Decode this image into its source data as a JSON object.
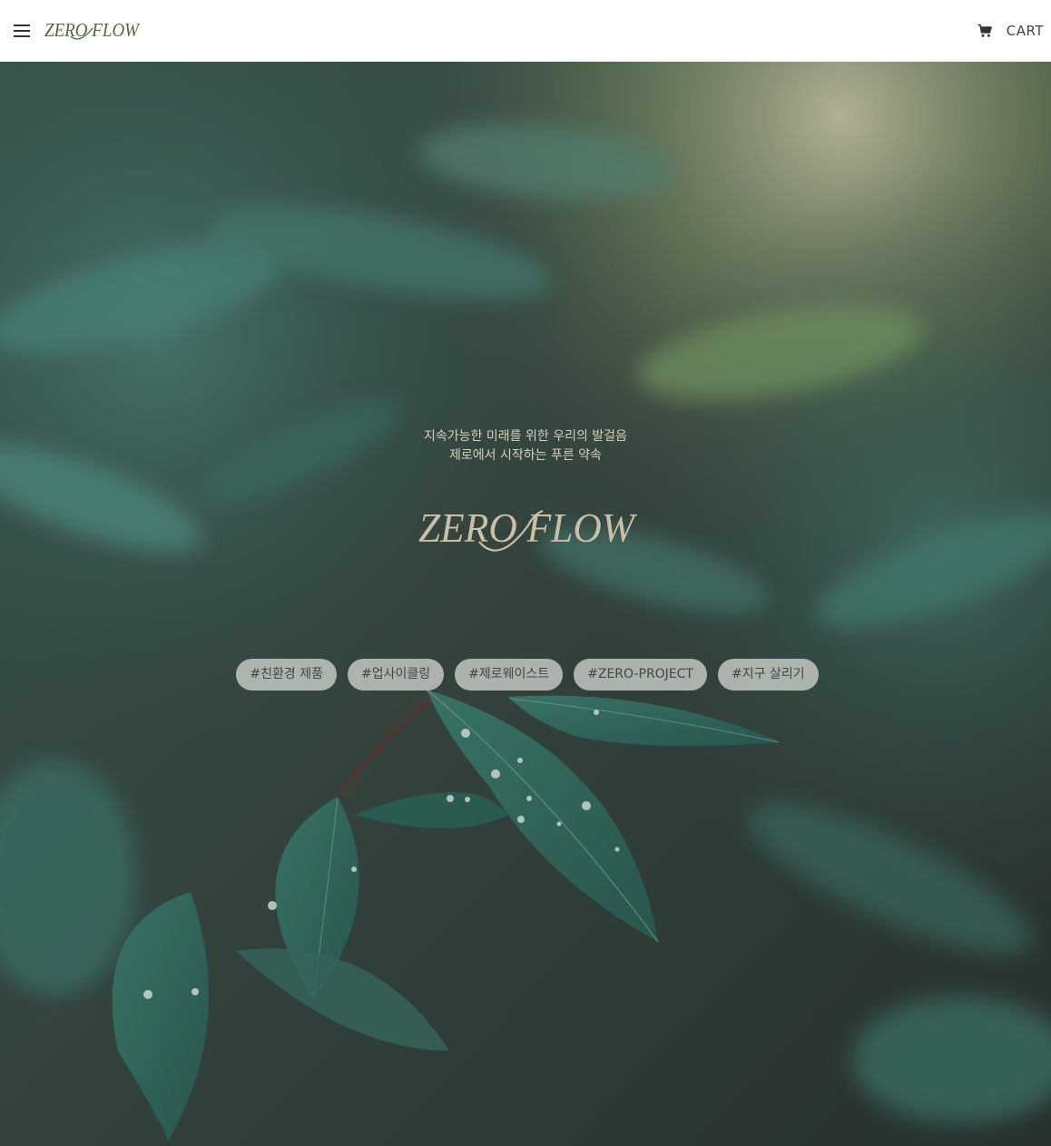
{
  "header": {
    "menu_icon": "hamburger-menu-icon",
    "logo_text": "ZERO FLOW",
    "cart_icon": "shopping-cart-icon",
    "cart_label": "CART"
  },
  "hero": {
    "tagline_line1": "지속가능한 미래를 위한 우리의 발걸음",
    "tagline_line2": "제로에서 시작하는 푸른 약속",
    "logo_text": "ZERO FLOW",
    "tags": [
      "#친환경 제품",
      "#업사이클링",
      "#제로웨이스트",
      "#ZERO-PROJECT",
      "#지구 살리기"
    ]
  },
  "colors": {
    "brand_green": "#4d6b3c",
    "logo_beige": "#cbbfa6",
    "tag_bg": "#c8ccc6",
    "tag_text": "#3c4a44"
  }
}
